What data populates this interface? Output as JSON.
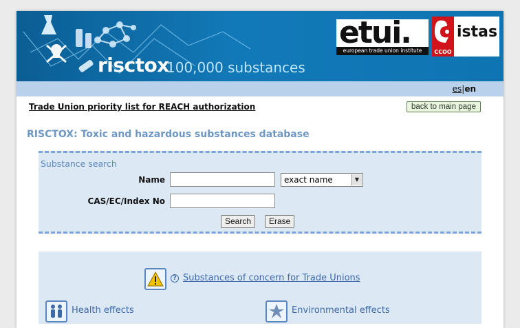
{
  "header": {
    "brand": "risctox",
    "tagline": "100,000 substances",
    "etui_logo_text": "etui.",
    "etui_logo_tagline": "european trade union institute",
    "istas_logo_text": "istas",
    "ccoo_logo_text": "CCOO"
  },
  "language": {
    "es": "es",
    "separator": "|",
    "en": "en"
  },
  "nav": {
    "priority_link": "Trade Union priority list for REACH authorization",
    "back_button": "back to main page"
  },
  "page_title": "RISCTOX: Toxic and hazardous substances database",
  "search": {
    "legend": "Substance search",
    "name_label": "Name",
    "name_value": "",
    "match_mode_selected": "exact name",
    "cas_label": "CAS/EC/Index No",
    "cas_value": "",
    "search_button": "Search",
    "erase_button": "Erase"
  },
  "concern": {
    "help_glyph": "?",
    "link": "Substances of concern for Trade Unions",
    "health_effects": "Health effects",
    "environmental_effects": "Environmental effects"
  },
  "colors": {
    "banner": "#1279b8",
    "lang_bar": "#b9d1eb",
    "panel": "#dde8f5",
    "accent_text": "#3c6aa8",
    "warning": "#f3c300"
  }
}
